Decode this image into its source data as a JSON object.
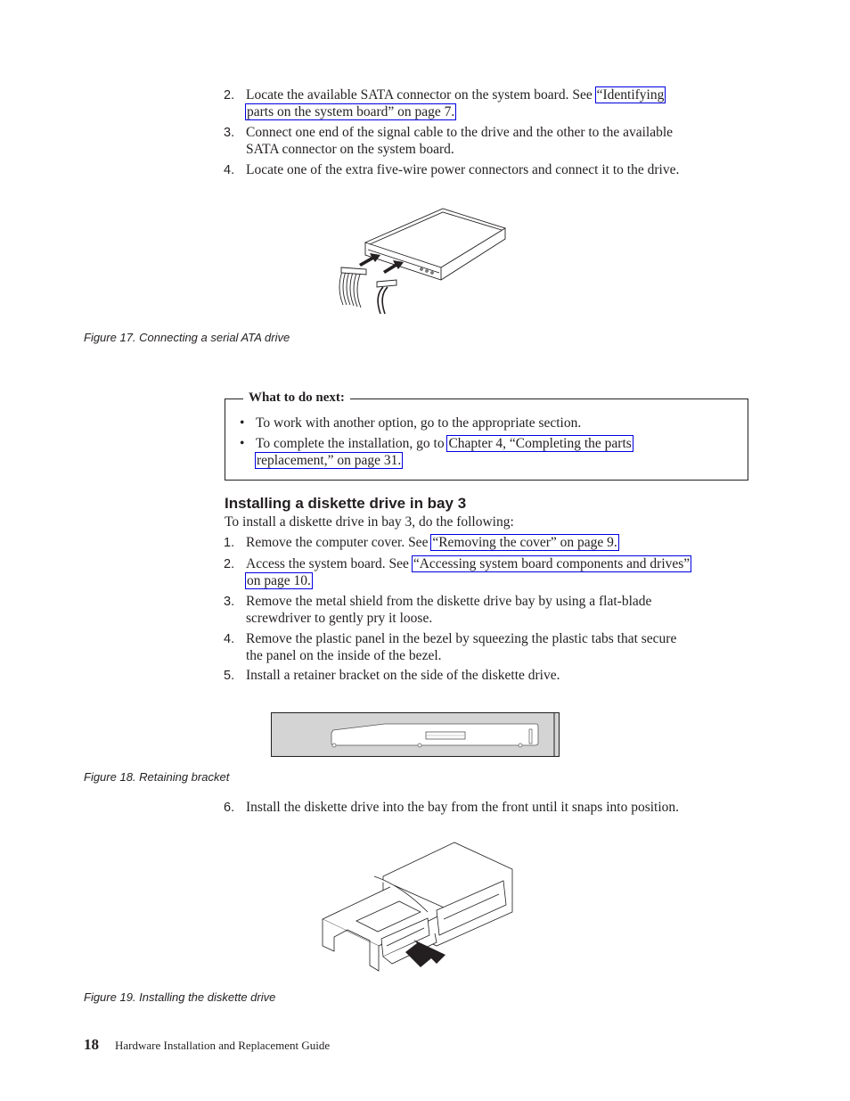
{
  "steps_top": [
    {
      "num": "2.",
      "pre": "Locate the available SATA connector on the system board. See ",
      "link1": "“Identifying",
      "link2": "parts on the system board” on page 7."
    },
    {
      "num": "3.",
      "line1": "Connect one end of the signal cable to the drive and the other to the available",
      "line2": "SATA connector on the system board."
    },
    {
      "num": "4.",
      "text": "Locate one of the extra five-wire power connectors and connect it to the drive."
    }
  ],
  "figure17": {
    "caption": "Figure 17. Connecting a serial ATA drive",
    "icon": "sata-drive-connection-illustration"
  },
  "next_box": {
    "title": "What to do next:",
    "bullet1": "To work with another option, go to the appropriate section.",
    "bullet2_pre": "To complete the installation, go to ",
    "bullet2_link1": "Chapter 4, “Completing the parts",
    "bullet2_link2": "replacement,” on page 31."
  },
  "section": {
    "heading": "Installing a diskette drive in bay 3",
    "intro": "To install a diskette drive in bay 3, do the following:",
    "steps": [
      {
        "num": "1.",
        "pre": "Remove the computer cover. See ",
        "link": "“Removing the cover” on page 9."
      },
      {
        "num": "2.",
        "pre": "Access the system board. See ",
        "link1": "“Accessing system board components and drives”",
        "link2": "on page 10."
      },
      {
        "num": "3.",
        "line1": "Remove the metal shield from the diskette drive bay by using a flat-blade",
        "line2": "screwdriver to gently pry it loose."
      },
      {
        "num": "4.",
        "line1": "Remove the plastic panel in the bezel by squeezing the plastic tabs that secure",
        "line2": "the panel on the inside of the bezel."
      },
      {
        "num": "5.",
        "text": "Install a retainer bracket on the side of the diskette drive."
      }
    ],
    "step6": {
      "num": "6.",
      "text": "Install the diskette drive into the bay from the front until it snaps into position."
    }
  },
  "figure18": {
    "caption": "Figure 18. Retaining bracket",
    "icon": "retaining-bracket-illustration"
  },
  "figure19": {
    "caption": "Figure 19. Installing the diskette drive",
    "icon": "diskette-drive-install-illustration"
  },
  "footer": {
    "page_number": "18",
    "title": "Hardware Installation and Replacement Guide"
  }
}
